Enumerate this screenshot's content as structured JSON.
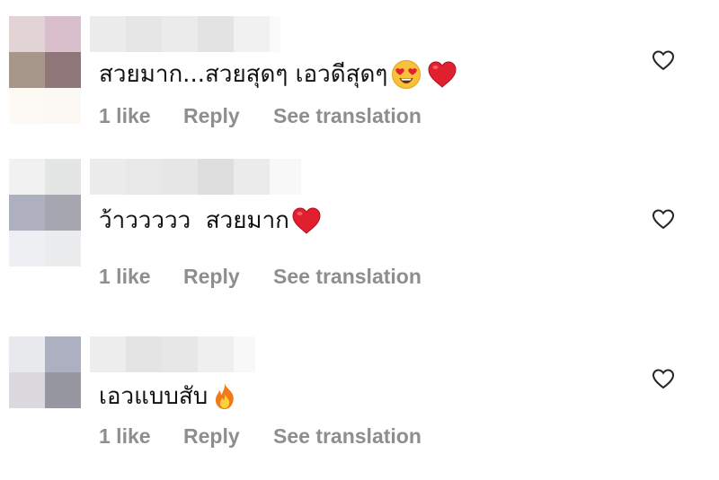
{
  "comments": [
    {
      "text": "สวยมาก...สวยสุดๆ เอวดีสุดๆ",
      "emoji": [
        "smiling-face-with-heart-eyes",
        "red-heart"
      ],
      "likes": "1 like",
      "reply": "Reply",
      "translate": "See translation"
    },
    {
      "text": "ว้าววววว  สวยมาก",
      "emoji": [
        "red-heart"
      ],
      "likes": "1 like",
      "reply": "Reply",
      "translate": "See translation"
    },
    {
      "text": "เอวแบบสับ",
      "emoji": [
        "fire"
      ],
      "likes": "1 like",
      "reply": "Reply",
      "translate": "See translation"
    }
  ],
  "colors": {
    "meta_text": "#8e8e8e",
    "heart_emoji": "#e0202e",
    "like_outline": "#262626"
  }
}
